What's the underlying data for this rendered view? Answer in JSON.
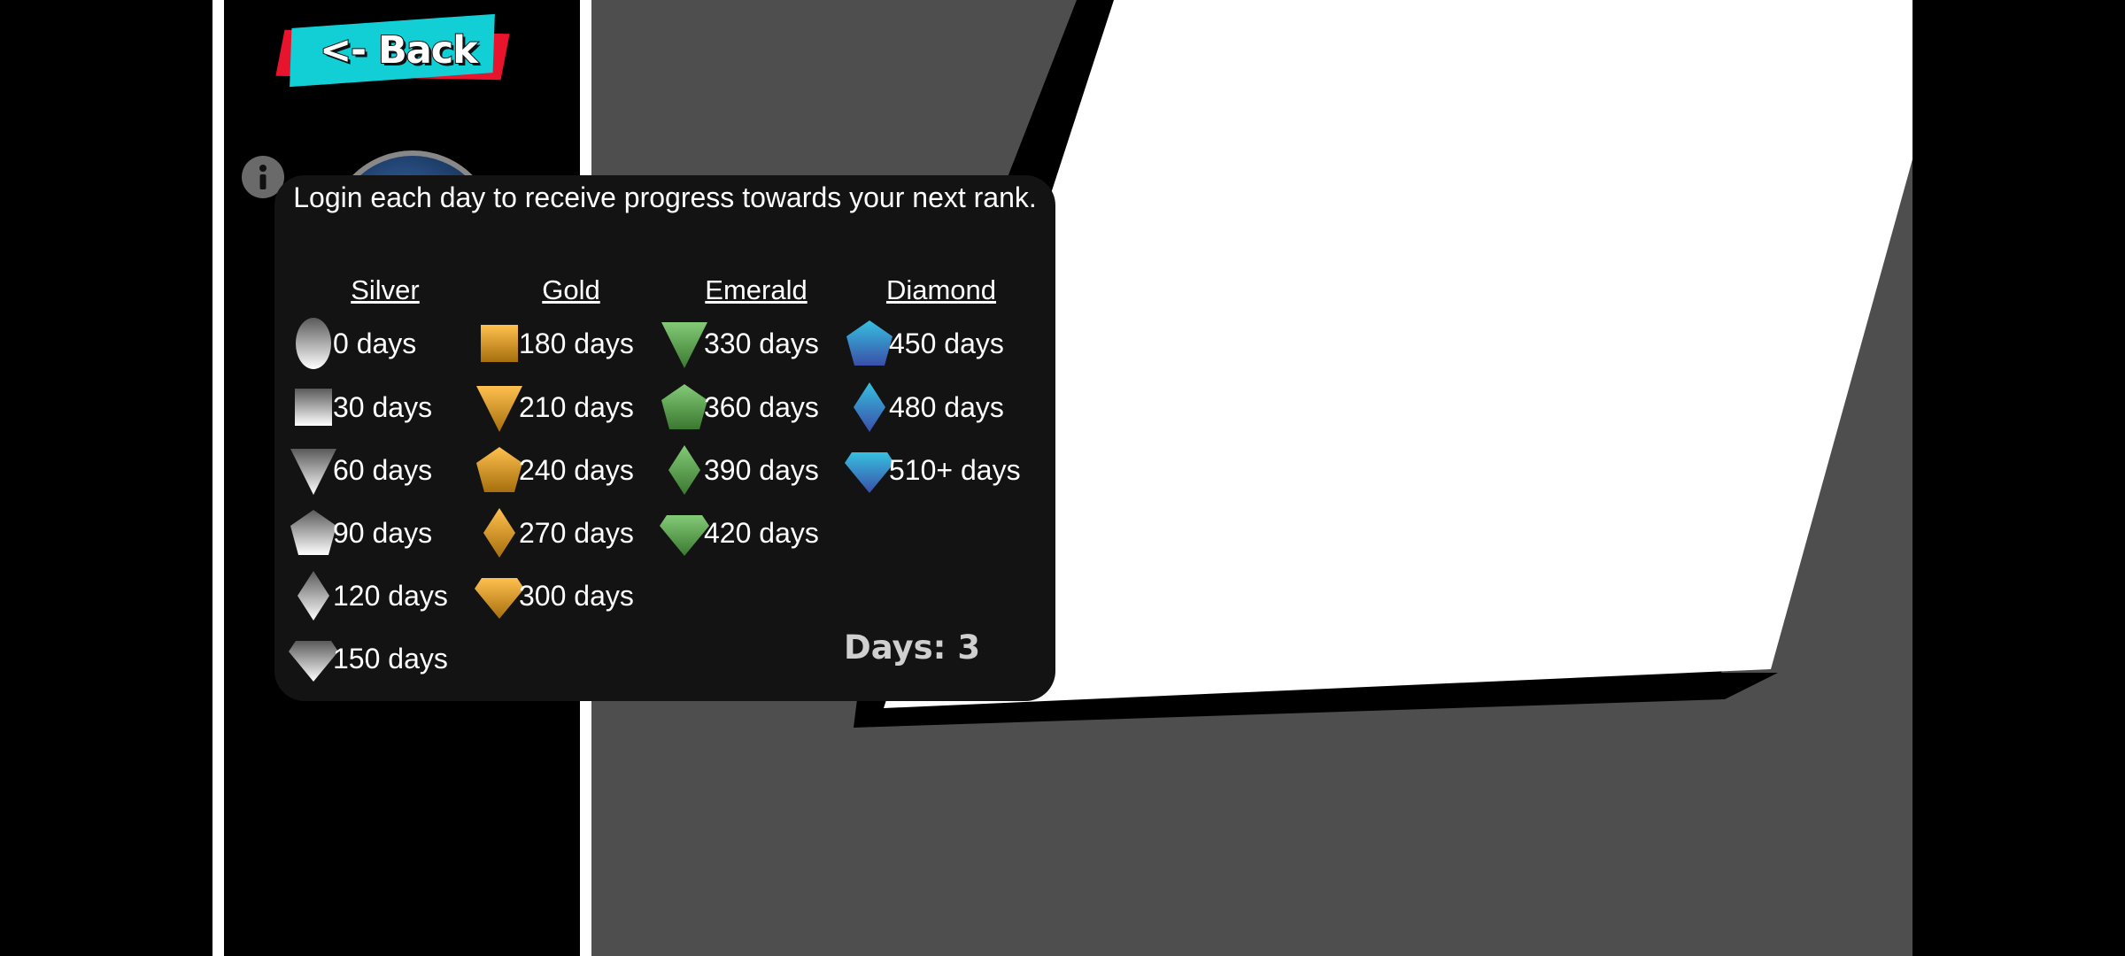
{
  "back_button": {
    "label": "<- Back"
  },
  "info_icon": {
    "glyph": "i"
  },
  "popup": {
    "intro": "Login each day to receive progress towards your next rank.",
    "days_label": "Days: 3",
    "columns": [
      {
        "name": "Silver",
        "color": "#c8c8c8",
        "tiers": [
          {
            "icon": "oval-icon",
            "label": "0 days"
          },
          {
            "icon": "square-icon",
            "label": "30 days"
          },
          {
            "icon": "triangle-icon",
            "label": "60 days"
          },
          {
            "icon": "pentagon-icon",
            "label": "90 days"
          },
          {
            "icon": "diamond-icon",
            "label": "120 days"
          },
          {
            "icon": "gem-icon",
            "label": "150 days"
          }
        ]
      },
      {
        "name": "Gold",
        "color": "#ffab14",
        "tiers": [
          {
            "icon": "square-icon",
            "label": "180 days"
          },
          {
            "icon": "triangle-icon",
            "label": "210 days"
          },
          {
            "icon": "pentagon-icon",
            "label": "240 days"
          },
          {
            "icon": "diamond-icon",
            "label": "270 days"
          },
          {
            "icon": "gem-icon",
            "label": "300 days"
          }
        ]
      },
      {
        "name": "Emerald",
        "color": "#5ab94a",
        "tiers": [
          {
            "icon": "triangle-icon",
            "label": "330 days"
          },
          {
            "icon": "pentagon-icon",
            "label": "360 days"
          },
          {
            "icon": "diamond-icon",
            "label": "390 days"
          },
          {
            "icon": "gem-icon",
            "label": "420 days"
          }
        ]
      },
      {
        "name": "Diamond",
        "color": "#2a8fd0",
        "tiers": [
          {
            "icon": "pentagon-icon",
            "label": "450 days"
          },
          {
            "icon": "diamond-icon",
            "label": "480 days"
          },
          {
            "icon": "gem-icon",
            "label": "510+ days"
          }
        ]
      }
    ]
  }
}
